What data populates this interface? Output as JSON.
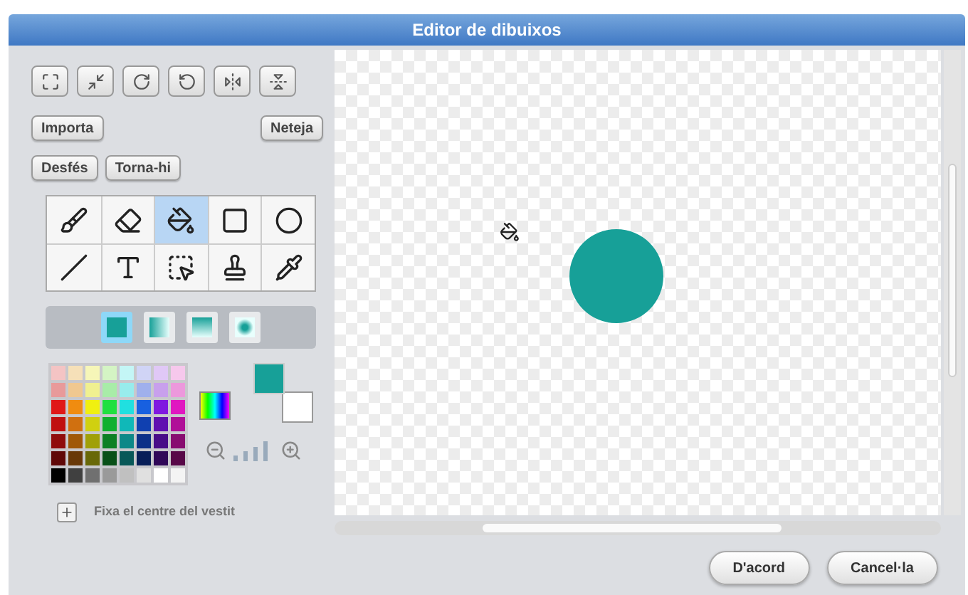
{
  "window": {
    "title": "Editor de dibuixos"
  },
  "transform_buttons": [
    {
      "kind": "grow"
    },
    {
      "kind": "shrink"
    },
    {
      "kind": "rotate-right"
    },
    {
      "kind": "rotate-left"
    },
    {
      "kind": "flip-h"
    },
    {
      "kind": "flip-v"
    }
  ],
  "import_button": "Importa",
  "clear_button": "Neteja",
  "undo_button": "Desfés",
  "redo_button": "Torna-hi",
  "tools": [
    {
      "kind": "brush",
      "selected": false
    },
    {
      "kind": "eraser",
      "selected": false
    },
    {
      "kind": "fill",
      "selected": true
    },
    {
      "kind": "rectangle",
      "selected": false
    },
    {
      "kind": "ellipse",
      "selected": false
    },
    {
      "kind": "line",
      "selected": false
    },
    {
      "kind": "text",
      "selected": false
    },
    {
      "kind": "select",
      "selected": false
    },
    {
      "kind": "stamp",
      "selected": false
    },
    {
      "kind": "eyedropper",
      "selected": false
    }
  ],
  "fill_modes": [
    {
      "kind": "solid",
      "selected": true
    },
    {
      "kind": "horizontal",
      "selected": false
    },
    {
      "kind": "vertical",
      "selected": false
    },
    {
      "kind": "radial",
      "selected": false
    }
  ],
  "palette": [
    {
      "color": "#f4c4c4"
    },
    {
      "color": "#f6e0b8"
    },
    {
      "color": "#f6f6b8"
    },
    {
      "color": "#d4f4c4"
    },
    {
      "color": "#c4f6f6"
    },
    {
      "color": "#d0d4f6"
    },
    {
      "color": "#e0c8f6"
    },
    {
      "color": "#f6c8ec"
    },
    {
      "color": "#e89a9a"
    },
    {
      "color": "#f0c890"
    },
    {
      "color": "#f0f090"
    },
    {
      "color": "#a8eca8"
    },
    {
      "color": "#98ecec"
    },
    {
      "color": "#a0b0ec"
    },
    {
      "color": "#c8a0ec"
    },
    {
      "color": "#ec98dc"
    },
    {
      "color": "#e01818"
    },
    {
      "color": "#f08c10"
    },
    {
      "color": "#f0f010"
    },
    {
      "color": "#20e040"
    },
    {
      "color": "#20e0e0"
    },
    {
      "color": "#1860e0"
    },
    {
      "color": "#8018e0"
    },
    {
      "color": "#e018c0"
    },
    {
      "color": "#c01010"
    },
    {
      "color": "#d07010"
    },
    {
      "color": "#d0d010"
    },
    {
      "color": "#10b030"
    },
    {
      "color": "#10b8b8"
    },
    {
      "color": "#1040b0"
    },
    {
      "color": "#6010b0"
    },
    {
      "color": "#b01098"
    },
    {
      "color": "#900c0c"
    },
    {
      "color": "#a05808"
    },
    {
      "color": "#a0a008"
    },
    {
      "color": "#0c8024"
    },
    {
      "color": "#0c8888"
    },
    {
      "color": "#0c3088"
    },
    {
      "color": "#480c88"
    },
    {
      "color": "#880c70"
    },
    {
      "color": "#600808"
    },
    {
      "color": "#683808"
    },
    {
      "color": "#686808"
    },
    {
      "color": "#085018"
    },
    {
      "color": "#085858"
    },
    {
      "color": "#081e58"
    },
    {
      "color": "#300858"
    },
    {
      "color": "#580848"
    },
    {
      "color": "#000000"
    },
    {
      "color": "#404040"
    },
    {
      "color": "#707070"
    },
    {
      "color": "#9a9a9a"
    },
    {
      "color": "#c0c0c0"
    },
    {
      "color": "#e0e0e0"
    },
    {
      "color": "#ffffff"
    },
    {
      "color": "#f4f4f4"
    }
  ],
  "current_colors": [
    {
      "kind": "foreground",
      "color": "#17a098"
    },
    {
      "kind": "background",
      "color": "#ffffff"
    }
  ],
  "set_center": {
    "label": "Fixa el centre del vestit"
  },
  "canvas": {
    "shapes": [
      {
        "kind": "circle",
        "color": "#17a098"
      }
    ]
  },
  "buttons": [
    "D'acord",
    "Cancel·la"
  ]
}
